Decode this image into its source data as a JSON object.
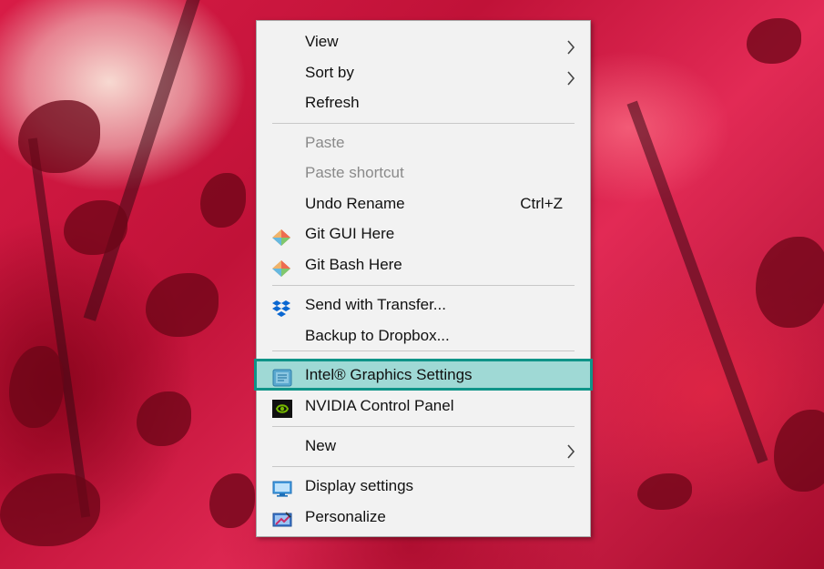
{
  "menu": {
    "items": [
      {
        "label": "View",
        "submenu": true
      },
      {
        "label": "Sort by",
        "submenu": true
      },
      {
        "label": "Refresh"
      },
      {
        "label": "Paste",
        "disabled": true
      },
      {
        "label": "Paste shortcut",
        "disabled": true
      },
      {
        "label": "Undo Rename",
        "shortcut": "Ctrl+Z"
      },
      {
        "label": "Git GUI Here",
        "icon": "git-icon"
      },
      {
        "label": "Git Bash Here",
        "icon": "git-icon"
      },
      {
        "label": "Send with Transfer...",
        "icon": "dropbox-icon"
      },
      {
        "label": "Backup to Dropbox..."
      },
      {
        "label": "Intel® Graphics Settings",
        "icon": "intel-graphics-icon",
        "highlighted": true
      },
      {
        "label": "NVIDIA Control Panel",
        "icon": "nvidia-icon"
      },
      {
        "label": "New",
        "submenu": true
      },
      {
        "label": "Display settings",
        "icon": "display-icon"
      },
      {
        "label": "Personalize",
        "icon": "personalize-icon"
      }
    ]
  },
  "colors": {
    "highlight_fill": "#9fd9d5",
    "highlight_border": "#0f9488",
    "menu_background": "#f2f2f2"
  }
}
